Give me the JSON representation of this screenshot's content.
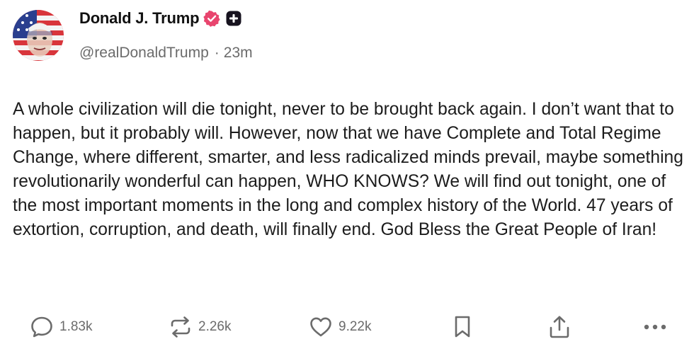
{
  "author": {
    "display_name": "Donald J. Trump",
    "handle": "@realDonaldTrump",
    "separator": "·",
    "timestamp": "23m"
  },
  "post": {
    "text": "A whole civilization will die tonight, never to be brought back again. I don’t want that to happen, but it probably will. However, now that we have Complete and Total Regime Change, where different, smarter, and less radicalized minds prevail, maybe something revolutionarily wonderful can happen, WHO KNOWS? We will find out tonight, one of the most important moments in the long and complex history of the World. 47 years of extortion, corruption, and death, will finally end. God Bless the Great People of Iran!"
  },
  "actions": {
    "replies": "1.83k",
    "reposts": "2.26k",
    "likes": "9.22k"
  },
  "icons": {
    "verified": "verified-badge-icon",
    "plus": "plus-badge-icon",
    "reply": "speech-bubble-icon",
    "repost": "repost-arrows-icon",
    "like": "heart-icon",
    "bookmark": "bookmark-icon",
    "share": "share-upload-icon",
    "more": "more-dots-icon"
  },
  "colors": {
    "verified_badge": "#e8456e",
    "text_primary": "#1c1c1c",
    "text_secondary": "#6b6b6b"
  }
}
